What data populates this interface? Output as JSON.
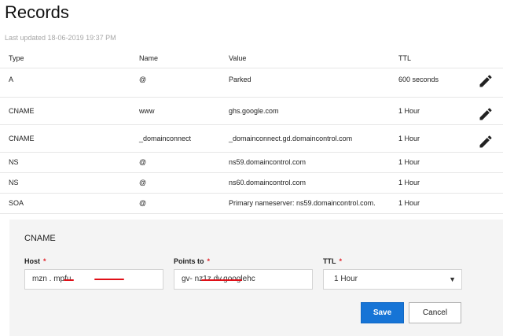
{
  "page": {
    "title": "Records",
    "last_updated": "Last updated 18-06-2019 19:37 PM"
  },
  "table": {
    "headers": {
      "type": "Type",
      "name": "Name",
      "value": "Value",
      "ttl": "TTL"
    },
    "rows": [
      {
        "type": "A",
        "name": "@",
        "value": "Parked",
        "ttl": "600 seconds",
        "editable": true
      },
      {
        "type": "CNAME",
        "name": "www",
        "value": "ghs.google.com",
        "ttl": "1 Hour",
        "editable": true
      },
      {
        "type": "CNAME",
        "name": "_domainconnect",
        "value": "_domainconnect.gd.domaincontrol.com",
        "ttl": "1 Hour",
        "editable": true
      },
      {
        "type": "NS",
        "name": "@",
        "value": "ns59.domaincontrol.com",
        "ttl": "1 Hour",
        "editable": false
      },
      {
        "type": "NS",
        "name": "@",
        "value": "ns60.domaincontrol.com",
        "ttl": "1 Hour",
        "editable": false
      },
      {
        "type": "SOA",
        "name": "@",
        "value": "Primary nameserver: ns59.domaincontrol.com.",
        "ttl": "1 Hour",
        "editable": false
      }
    ]
  },
  "edit_form": {
    "record_type": "CNAME",
    "host": {
      "label": "Host",
      "value": "mzn .  mpfu"
    },
    "points_to": {
      "label": "Points to",
      "value": "gv-  nz1z.dv.googlehc"
    },
    "ttl": {
      "label": "TTL",
      "selected": "1 Hour"
    },
    "required_marker": "*",
    "save_label": "Save",
    "cancel_label": "Cancel"
  },
  "icons": {
    "edit": "pencil-icon",
    "delete": "trash-icon",
    "select_caret": "triangle-down-icon"
  },
  "colors": {
    "primary_button": "#1674d6",
    "required": "#e0242b",
    "redaction": "#e01018",
    "panel_bg": "#f4f4f4"
  }
}
